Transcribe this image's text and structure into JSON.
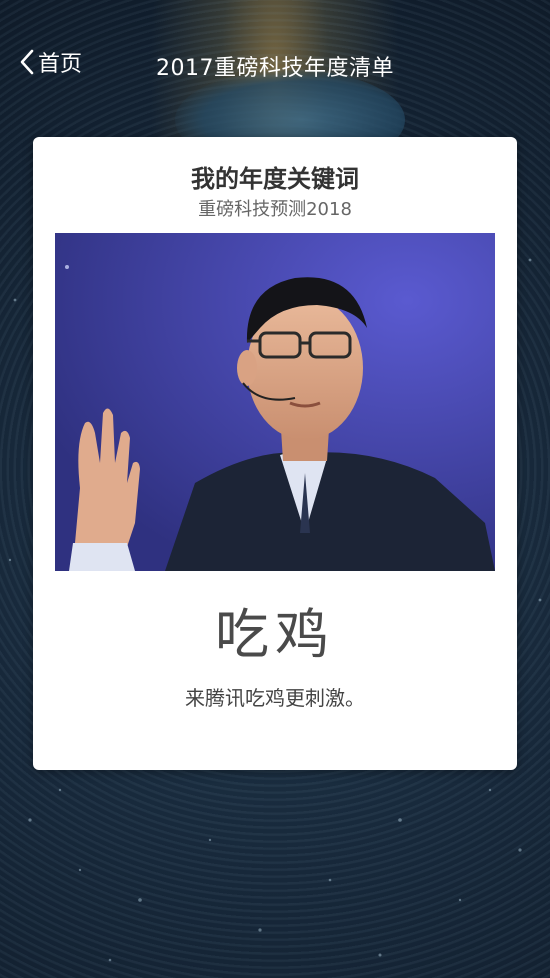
{
  "header": {
    "back_label": "首页",
    "title": "2017重磅科技年度清单"
  },
  "card": {
    "title": "我的年度关键词",
    "subtitle": "重磅科技预测2018",
    "keyword": "吃鸡",
    "description": "来腾讯吃鸡更刺激。"
  },
  "colors": {
    "card_background": "#ffffff",
    "photo_background": "#4a4bb8",
    "page_background": "#17283a"
  }
}
